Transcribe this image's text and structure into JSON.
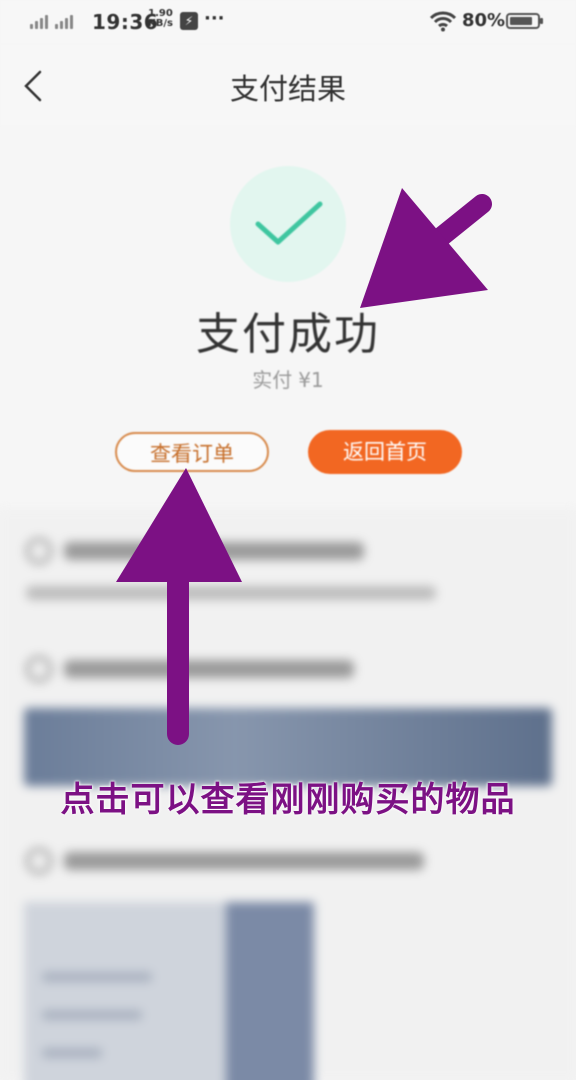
{
  "status_bar": {
    "time": "19:36",
    "speed_value": "1.90",
    "speed_unit": "KB/s",
    "more": "···",
    "battery": "80%"
  },
  "header": {
    "title": "支付结果"
  },
  "result": {
    "title": "支付成功",
    "paid_label": "实付",
    "paid_amount": "¥1",
    "view_order_button": "查看订单",
    "home_button": "返回首页"
  },
  "annotation": {
    "caption": "点击可以查看刚刚购买的物品",
    "color": "#7c1184"
  },
  "colors": {
    "accent_orange": "#f26722",
    "success_green": "#3fc6a0"
  }
}
